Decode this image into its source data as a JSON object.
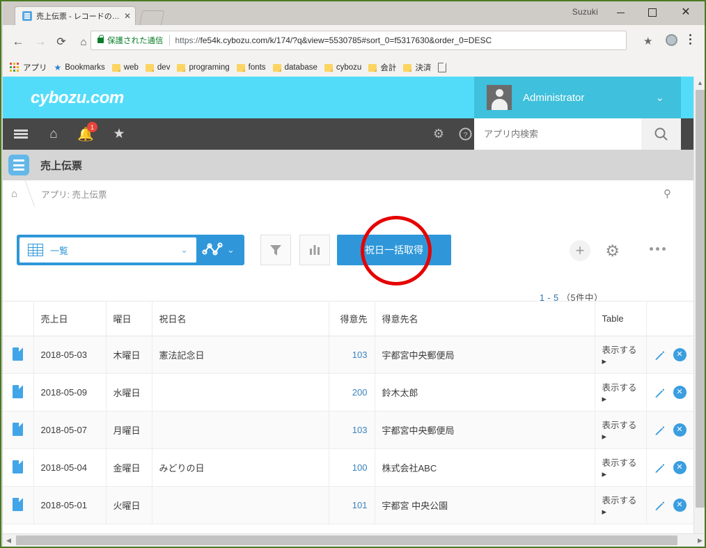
{
  "browser": {
    "window_user": "Suzuki",
    "minimize": "−",
    "maximize": "□",
    "close": "✕",
    "tab_title": "売上伝票 - レコードの一覧",
    "tab_close": "✕",
    "back": "←",
    "forward": "→",
    "reload": "⟳",
    "home": "⌂",
    "secure_label": "保護された通信",
    "url_scheme": "https://",
    "url_rest": "fe54k.cybozu.com/k/174/?q&view=5530785#sort_0=f5317630&order_0=DESC",
    "bookmark_star": "★",
    "bookmarks": [
      {
        "label": "アプリ",
        "icon": "apps-grid-icon"
      },
      {
        "label": "Bookmarks",
        "icon": "star-icon"
      },
      {
        "label": "web",
        "icon": "folder-icon"
      },
      {
        "label": "dev",
        "icon": "folder-icon"
      },
      {
        "label": "programing",
        "icon": "folder-icon"
      },
      {
        "label": "fonts",
        "icon": "folder-icon"
      },
      {
        "label": "database",
        "icon": "folder-icon"
      },
      {
        "label": "cybozu",
        "icon": "folder-icon"
      },
      {
        "label": "会計",
        "icon": "folder-icon"
      },
      {
        "label": "決済",
        "icon": "folder-icon"
      }
    ]
  },
  "header": {
    "logo": "cybozu.com",
    "user_name": "Administrator",
    "user_caret": "⌄",
    "notification_count": "1",
    "search_placeholder": "アプリ内検索"
  },
  "app": {
    "title": "売上伝票",
    "breadcrumb": "アプリ: 売上伝票"
  },
  "toolbar": {
    "view_name": "一覧",
    "view_caret": "⌄",
    "chart_caret": "⌄",
    "action_button": "祝日一括取得",
    "add_label": "+",
    "record_count": "1 - 5 （5件中）",
    "record_range": "1 - 5",
    "record_total": "（5件中）"
  },
  "table": {
    "columns": [
      "売上日",
      "曜日",
      "祝日名",
      "得意先",
      "得意先名",
      "Table"
    ],
    "show_label": "表示する",
    "show_arrow": "▸",
    "delete_glyph": "✕",
    "rows": [
      {
        "date": "2018-05-03",
        "dow": "木曜日",
        "holiday": "憲法記念日",
        "cust": "103",
        "cust_name": "宇都宮中央郵便局",
        "table": "表示する"
      },
      {
        "date": "2018-05-09",
        "dow": "水曜日",
        "holiday": "",
        "cust": "200",
        "cust_name": "鈴木太郎",
        "table": "表示する"
      },
      {
        "date": "2018-05-07",
        "dow": "月曜日",
        "holiday": "",
        "cust": "103",
        "cust_name": "宇都宮中央郵便局",
        "table": "表示する"
      },
      {
        "date": "2018-05-04",
        "dow": "金曜日",
        "holiday": "みどりの日",
        "cust": "100",
        "cust_name": "株式会社ABC",
        "table": "表示する"
      },
      {
        "date": "2018-05-01",
        "dow": "火曜日",
        "holiday": "",
        "cust": "101",
        "cust_name": "宇都宮 中央公園",
        "table": "表示する"
      }
    ]
  },
  "colors": {
    "brand_cyan": "#53DCFA",
    "user_cyan": "#3FC0DC",
    "navbar_dark": "#474747",
    "accent_blue": "#2F97D9",
    "badge_red": "#e8453c",
    "annotation_red": "#e60000",
    "link_blue": "#3a82bd"
  }
}
